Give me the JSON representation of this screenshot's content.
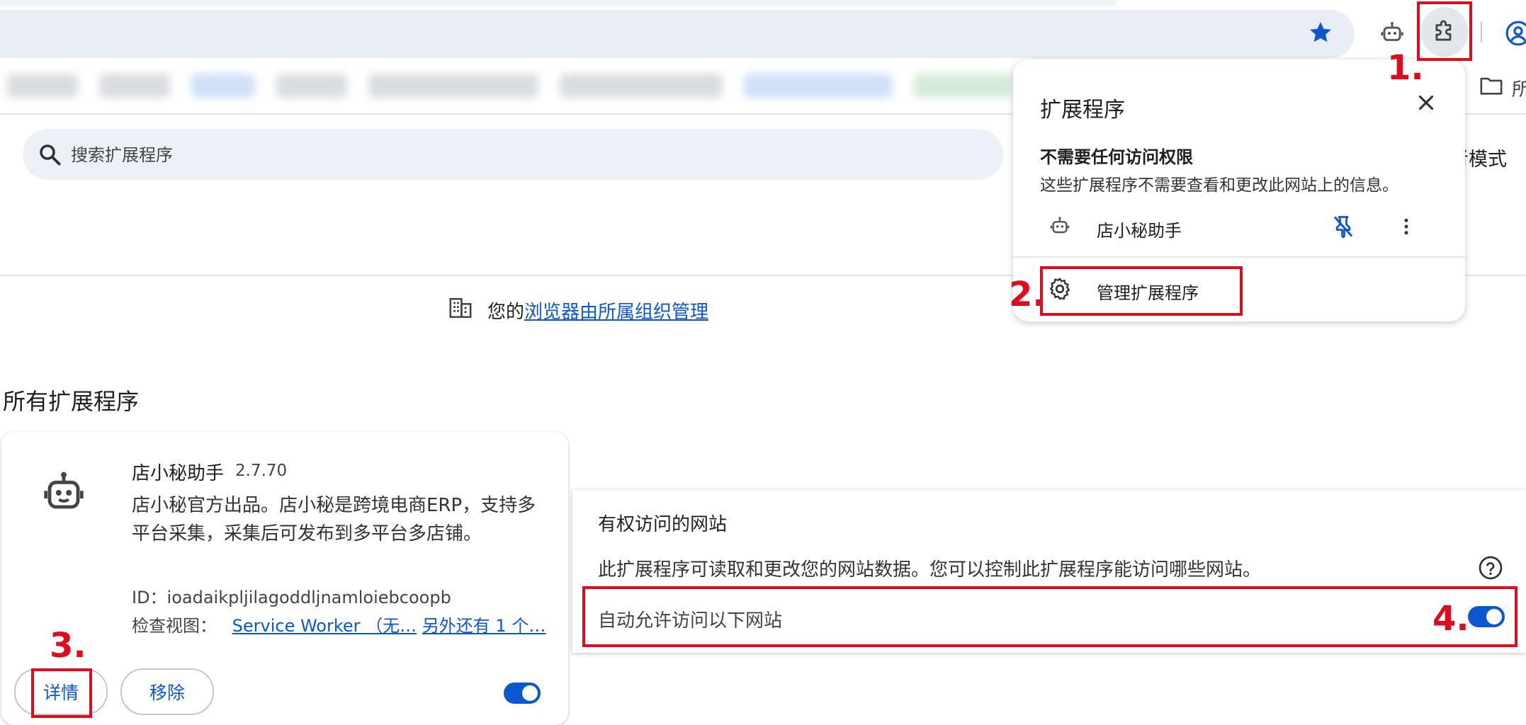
{
  "colors": {
    "accent": "#0b57d0",
    "annotation": "#e00b1d",
    "toggle_on": "#0b57d0"
  },
  "toolbar": {
    "bookmark_icon": "star-icon",
    "assistant_icon": "robot-icon",
    "extensions_icon": "puzzle-icon",
    "profile_icon": "account-circle-icon"
  },
  "bookmarks_bar": {
    "folder_label": "所"
  },
  "search": {
    "placeholder": "搜索扩展程序"
  },
  "developer_mode": {
    "label": "者模式"
  },
  "managed_notice": {
    "prefix": "您的",
    "link": "浏览器由所属组织管理"
  },
  "section_title": "所有扩展程序",
  "extension_card": {
    "name": "店小秘助手",
    "version": "2.7.70",
    "description": "店小秘官方出品。店小秘是跨境电商ERP，支持多平台采集，采集后可发布到多平台多店铺。",
    "id_label": "ID：ioadaikpljilagoddljnamloiebcoopb",
    "views_label": "检查视图：",
    "view_link_1": "Service Worker （无…",
    "view_link_2": "另外还有 1 个…",
    "details_button": "详情",
    "remove_button": "移除",
    "enabled": true
  },
  "site_access": {
    "title": "有权访问的网站",
    "description": "此扩展程序可读取和更改您的网站数据。您可以控制此扩展程序能访问哪些网站。",
    "auto_allow_label": "自动允许访问以下网站",
    "auto_allow_enabled": true
  },
  "popup": {
    "title": "扩展程序",
    "subheading": "不需要任何访问权限",
    "subdescription": "这些扩展程序不需要查看和更改此网站上的信息。",
    "item_name": "店小秘助手",
    "manage_label": "管理扩展程序"
  },
  "annotations": {
    "n1": "1.",
    "n2": "2.",
    "n3": "3.",
    "n4": "4."
  }
}
